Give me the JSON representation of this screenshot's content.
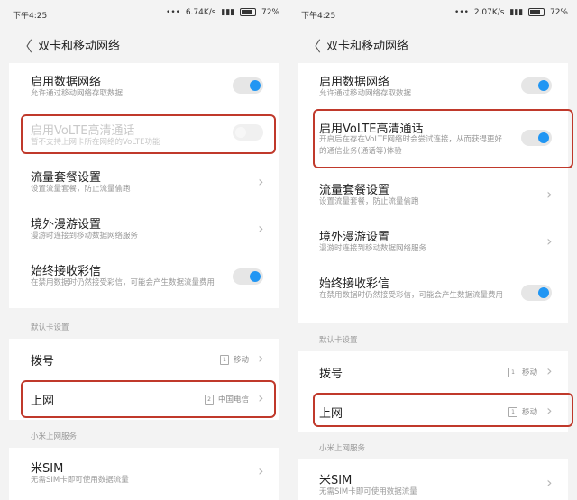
{
  "left": {
    "status": {
      "time": "下午4:25",
      "speed": "6.74K/s",
      "battery": "72%"
    },
    "nav": {
      "back": "〈",
      "title": "双卡和移动网络"
    },
    "rows": {
      "data": {
        "title": "启用数据网络",
        "sub": "允许通过移动网络存取数据",
        "toggle": "on"
      },
      "volte": {
        "title": "启用VoLTE高清通话",
        "sub": "暂不支持上网卡所在网络的VoLTE功能",
        "toggle": "disabled"
      },
      "plan": {
        "title": "流量套餐设置",
        "sub": "设置流量套餐，防止流量偷跑"
      },
      "roam": {
        "title": "境外漫游设置",
        "sub": "漫游时连接到移动数据网络服务"
      },
      "mms": {
        "title": "始终接收彩信",
        "sub": "在禁用数据时仍然接受彩信，可能会产生数据流量费用",
        "toggle": "on"
      },
      "default_label": "默认卡设置",
      "dial": {
        "title": "拨号",
        "sim": "1",
        "value": "移动"
      },
      "net": {
        "title": "上网",
        "sim": "2",
        "value": "中国电信"
      },
      "service_label": "小米上网服务",
      "misim": {
        "title": "米SIM",
        "sub": "无需SIM卡即可使用数据流量"
      }
    }
  },
  "right": {
    "status": {
      "time": "下午4:25",
      "speed": "2.07K/s",
      "battery": "72%"
    },
    "nav": {
      "back": "〈",
      "title": "双卡和移动网络"
    },
    "rows": {
      "data": {
        "title": "启用数据网络",
        "sub": "允许通过移动网络存取数据",
        "toggle": "on"
      },
      "volte": {
        "title": "启用VoLTE高清通话",
        "sub": "开启后在存在VoLTE网络时会尝试连接，从而获得更好的通信业务(通话等)体验",
        "toggle": "on"
      },
      "plan": {
        "title": "流量套餐设置",
        "sub": "设置流量套餐，防止流量偷跑"
      },
      "roam": {
        "title": "境外漫游设置",
        "sub": "漫游时连接到移动数据网络服务"
      },
      "mms": {
        "title": "始终接收彩信",
        "sub": "在禁用数据时仍然接受彩信，可能会产生数据流量费用",
        "toggle": "on"
      },
      "default_label": "默认卡设置",
      "dial": {
        "title": "拨号",
        "sim": "1",
        "value": "移动"
      },
      "net": {
        "title": "上网",
        "sim": "1",
        "value": "移动"
      },
      "service_label": "小米上网服务",
      "misim": {
        "title": "米SIM",
        "sub": "无需SIM卡即可使用数据流量"
      }
    }
  },
  "colors": {
    "accent": "#2196f3",
    "highlight": "#c0392b",
    "background": "#f3f3f3"
  },
  "icons": [
    "back-arrow-icon",
    "chevron-right-icon",
    "sim-icon",
    "battery-icon"
  ]
}
